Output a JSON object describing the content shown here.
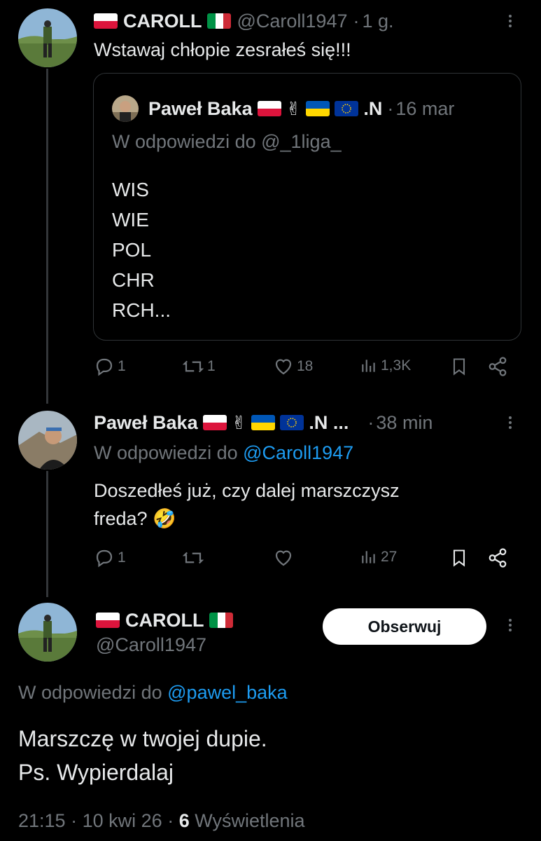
{
  "tweet1": {
    "name": "CAROLL",
    "handle": "@Caroll1947",
    "sep": "·",
    "time": "1 g.",
    "text": "Wstawaj chłopie zesrałeś się!!!",
    "quote": {
      "name": "Paweł Baka",
      "name_suffix": ".N",
      "sep": "·",
      "time": "16 mar",
      "reply_to": "W odpowiedzi do @_1liga_",
      "lines": [
        "WIS",
        "WIE",
        "POL",
        "CHR",
        "RCH..."
      ]
    },
    "stats": {
      "replies": "1",
      "reposts": "1",
      "likes": "18",
      "views": "1,3K"
    }
  },
  "tweet2": {
    "name": "Paweł Baka",
    "name_suffix": ".N ...",
    "sep": "·",
    "time": "38 min",
    "reply_prefix": "W odpowiedzi do",
    "reply_handle": "@Caroll1947",
    "text_line1": "Doszedłeś już, czy dalej marszczysz",
    "text_line2": "freda?",
    "emoji": "🤣",
    "stats": {
      "replies": "1",
      "views": "27"
    }
  },
  "main": {
    "name": "CAROLL",
    "handle": "@Caroll1947",
    "follow_label": "Obserwuj",
    "reply_prefix": "W odpowiedzi do",
    "reply_handle": "@pawel_baka",
    "text_line1": "Marszczę w twojej dupie.",
    "text_line2": "Ps. Wypierdalaj",
    "time": "21:15",
    "sep1": "·",
    "date": "10 kwi 26",
    "sep2": "·",
    "views_count": "6",
    "views_label": "Wyświetlenia"
  },
  "icons": {
    "reply": "reply-icon",
    "repost": "repost-icon",
    "like": "heart-icon",
    "views": "views-icon",
    "bookmark": "bookmark-icon",
    "share": "share-icon",
    "more": "more-icon"
  },
  "colors": {
    "bg": "#000000",
    "text": "#e7e9ea",
    "muted": "#71767b",
    "link": "#1d9bf0",
    "border": "#2f3336"
  }
}
